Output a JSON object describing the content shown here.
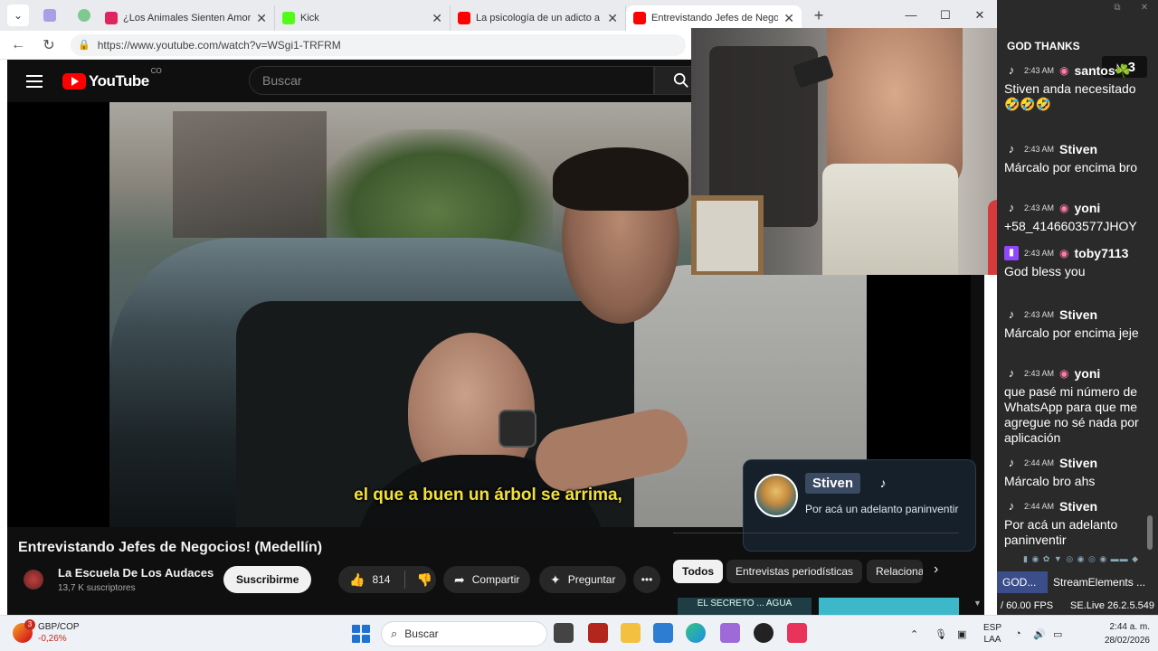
{
  "browser": {
    "tabs": [
      {
        "label": "¿Los Animales Sienten Amor? - Yo",
        "icon_color": "#e0245e"
      },
      {
        "label": "Kick",
        "icon_color": "#53fc18"
      },
      {
        "label": "La psicología de un adicto a la m",
        "icon_color": "#ff0000"
      },
      {
        "label": "Entrevistando Jefes de Negocios!",
        "icon_color": "#ff0000"
      }
    ],
    "url": "https://www.youtube.com/watch?v=WSgi1-TRFRM"
  },
  "youtube": {
    "logo_text": "YouTube",
    "country": "CO",
    "search_placeholder": "Buscar",
    "subtitle": "el que a buen un árbol se arrima,",
    "video_title": "Entrevistando Jefes de Negocios! (Medellín)",
    "channel_name": "La Escuela De Los Audaces",
    "channel_subs": "13,7 K suscriptores",
    "subscribe_label": "Suscribirme",
    "likes": "814",
    "share_label": "Compartir",
    "ask_label": "Preguntar",
    "chips": [
      "Todos",
      "Entrevistas periodísticas",
      "Relacionados"
    ],
    "thumb1_text": "EL SECRETO ... AGUA"
  },
  "notification": {
    "name": "Stiven",
    "message": "Por acá un adelanto paninventir"
  },
  "chat": {
    "header": "GOD THANKS",
    "tiktok_count": "3",
    "messages": [
      {
        "platform": "tiktok",
        "time": "2:43 AM",
        "user": "santos☘️",
        "text": "Stiven anda necesitado 🤣🤣🤣"
      },
      {
        "platform": "tiktok",
        "time": "2:43 AM",
        "user": "Stiven",
        "text": "Márcalo por encima bro"
      },
      {
        "platform": "tiktok",
        "time": "2:43 AM",
        "user": "yoni",
        "text": "+58_4146603577JHOY"
      },
      {
        "platform": "twitch",
        "time": "2:43 AM",
        "user": "toby7113",
        "text": "God bless you"
      },
      {
        "platform": "tiktok",
        "time": "2:43 AM",
        "user": "Stiven",
        "text": "Márcalo por encima jeje"
      },
      {
        "platform": "tiktok",
        "time": "2:43 AM",
        "user": "yoni",
        "text": "que pasé mi número de WhatsApp para que me agregue no sé nada por aplicación"
      },
      {
        "platform": "tiktok",
        "time": "2:44 AM",
        "user": "Stiven",
        "text": "Márcalo bro ahs"
      },
      {
        "platform": "tiktok",
        "time": "2:44 AM",
        "user": "Stiven",
        "text": "Por acá un adelanto paninventir"
      }
    ],
    "bottom_tabs": [
      "GOD...",
      "StreamElements ..."
    ],
    "fps": "/ 60.00 FPS",
    "version": "SE.Live 26.2.5.549"
  },
  "taskbar": {
    "widget_badge": "3",
    "widget_title": "GBP/COP",
    "widget_change": "-0,26%",
    "search_label": "Buscar",
    "lang_top": "ESP",
    "lang_bottom": "LAA",
    "time": "2:44 a. m.",
    "date": "28/02/2026"
  }
}
